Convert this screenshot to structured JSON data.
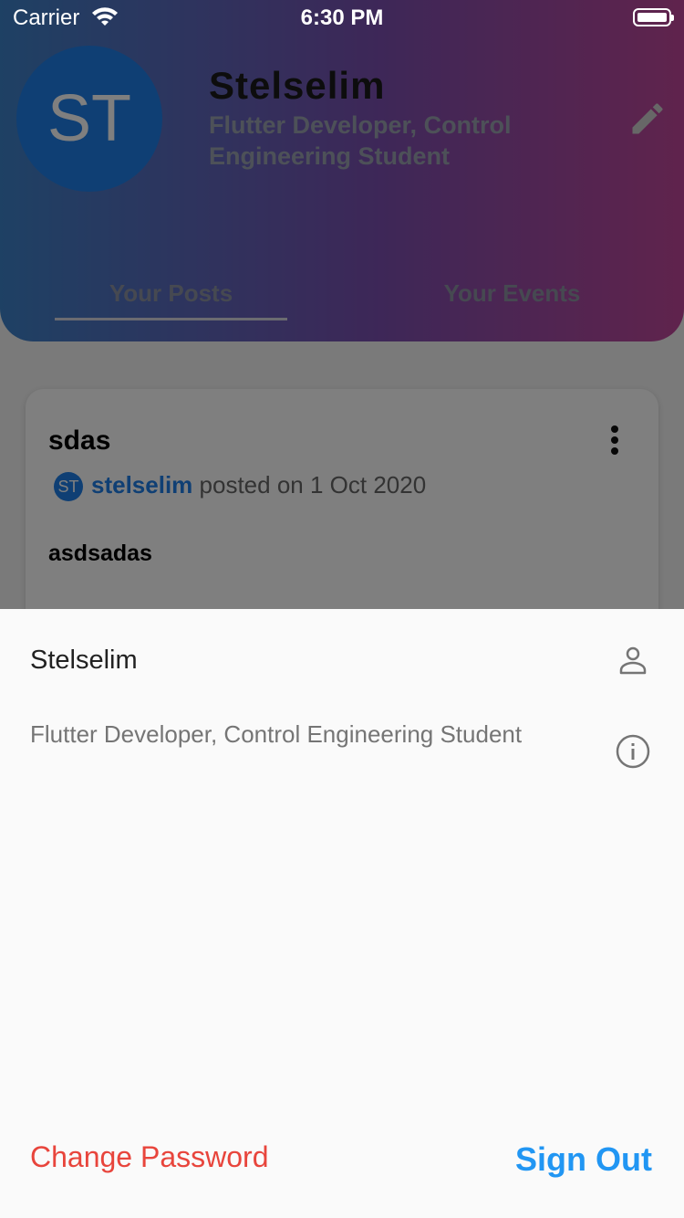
{
  "status_bar": {
    "carrier": "Carrier",
    "time": "6:30 PM"
  },
  "profile": {
    "initials": "ST",
    "name": "Stelselim",
    "bio": "Flutter Developer, Control Engineering Student"
  },
  "tabs": [
    {
      "label": "Your Posts",
      "selected": true
    },
    {
      "label": "Your Events",
      "selected": false
    }
  ],
  "post": {
    "title": "sdas",
    "author_initials": "ST",
    "author": "stelselim",
    "posted_on": "posted on 1 Oct 2020",
    "body": "asdsadas"
  },
  "sheet": {
    "name": "Stelselim",
    "bio": "Flutter Developer, Control Engineering Student",
    "change_password": "Change Password",
    "sign_out": "Sign Out"
  },
  "icons": {
    "edit": "pencil-icon",
    "more": "more-vert-icon",
    "person": "person-outline-icon",
    "info": "info-outline-icon"
  },
  "colors": {
    "accent_blue": "#2196f3",
    "danger_red": "#e8453c",
    "avatar_blue": "#1f7fe8"
  }
}
